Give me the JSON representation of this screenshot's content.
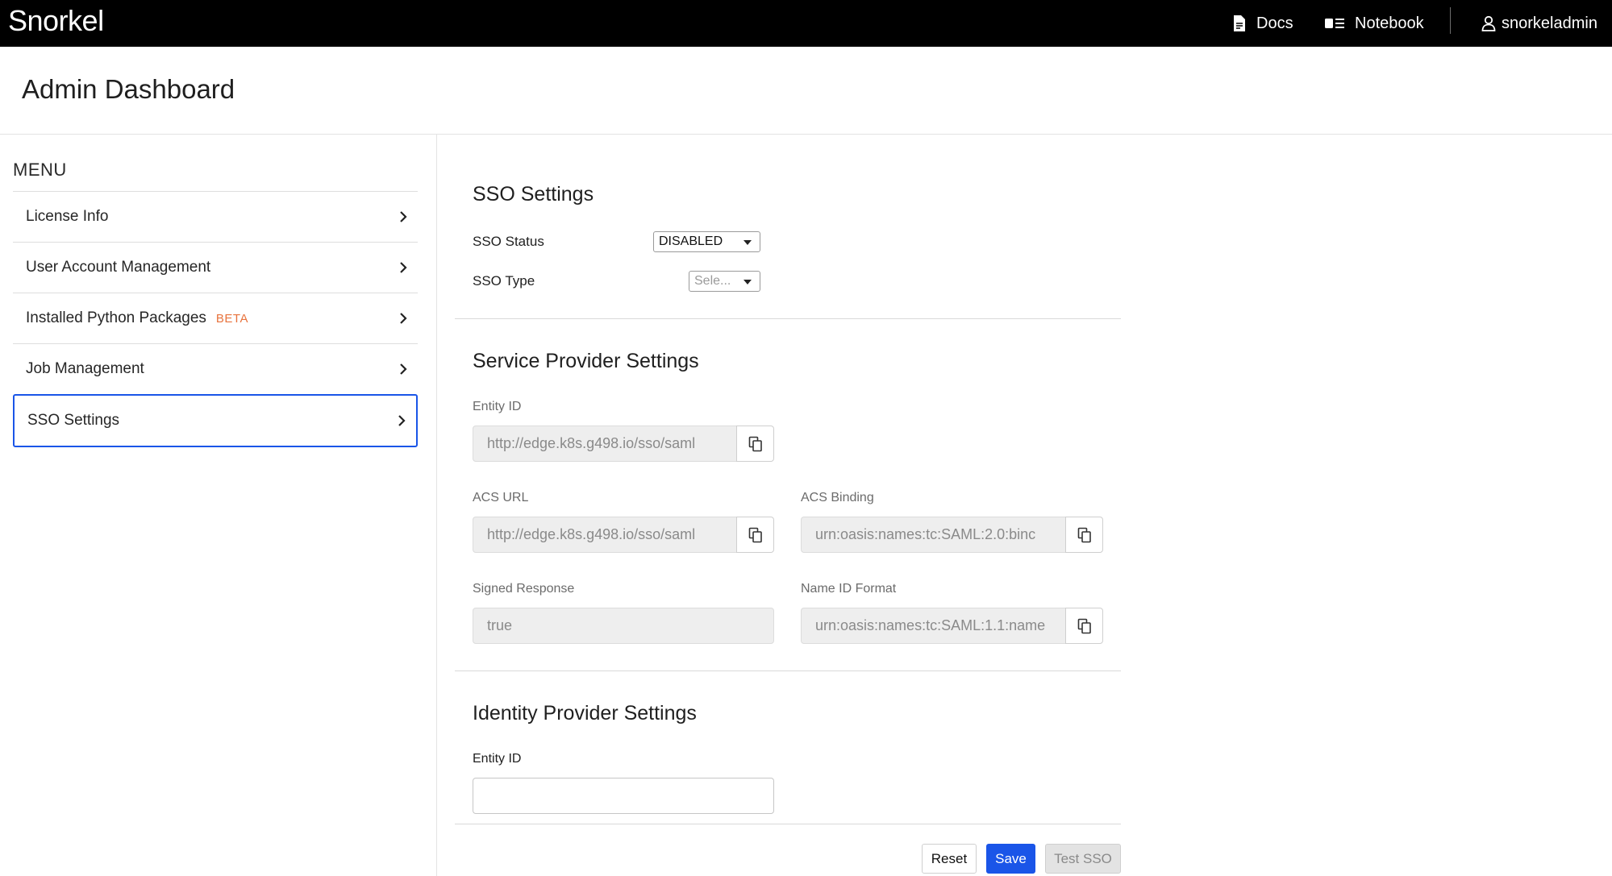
{
  "topbar": {
    "logo": "Snorkel",
    "docs": "Docs",
    "notebook": "Notebook",
    "user": "snorkeladmin"
  },
  "header": {
    "title": "Admin Dashboard"
  },
  "sidebar": {
    "menu_title": "MENU",
    "items": [
      {
        "label": "License Info"
      },
      {
        "label": "User Account Management"
      },
      {
        "label": "Installed Python Packages",
        "badge": "BETA"
      },
      {
        "label": "Job Management"
      },
      {
        "label": "SSO Settings",
        "active": true
      }
    ]
  },
  "sso": {
    "title": "SSO Settings",
    "status_label": "SSO Status",
    "status_value": "DISABLED",
    "type_label": "SSO Type",
    "type_placeholder": "Sele..."
  },
  "service_provider": {
    "title": "Service Provider Settings",
    "entity_id_label": "Entity ID",
    "entity_id_value": "http://edge.k8s.g498.io/sso/saml",
    "acs_url_label": "ACS URL",
    "acs_url_value": "http://edge.k8s.g498.io/sso/saml",
    "acs_binding_label": "ACS Binding",
    "acs_binding_value": "urn:oasis:names:tc:SAML:2.0:binc",
    "signed_response_label": "Signed Response",
    "signed_response_value": "true",
    "name_id_format_label": "Name ID Format",
    "name_id_format_value": "urn:oasis:names:tc:SAML:1.1:name"
  },
  "identity_provider": {
    "title": "Identity Provider Settings",
    "entity_id_label": "Entity ID",
    "entity_id_value": ""
  },
  "actions": {
    "reset": "Reset",
    "save": "Save",
    "test": "Test SSO"
  },
  "colors": {
    "accent": "#1a55e8",
    "beta": "#e8733d",
    "topbar": "#000000"
  }
}
